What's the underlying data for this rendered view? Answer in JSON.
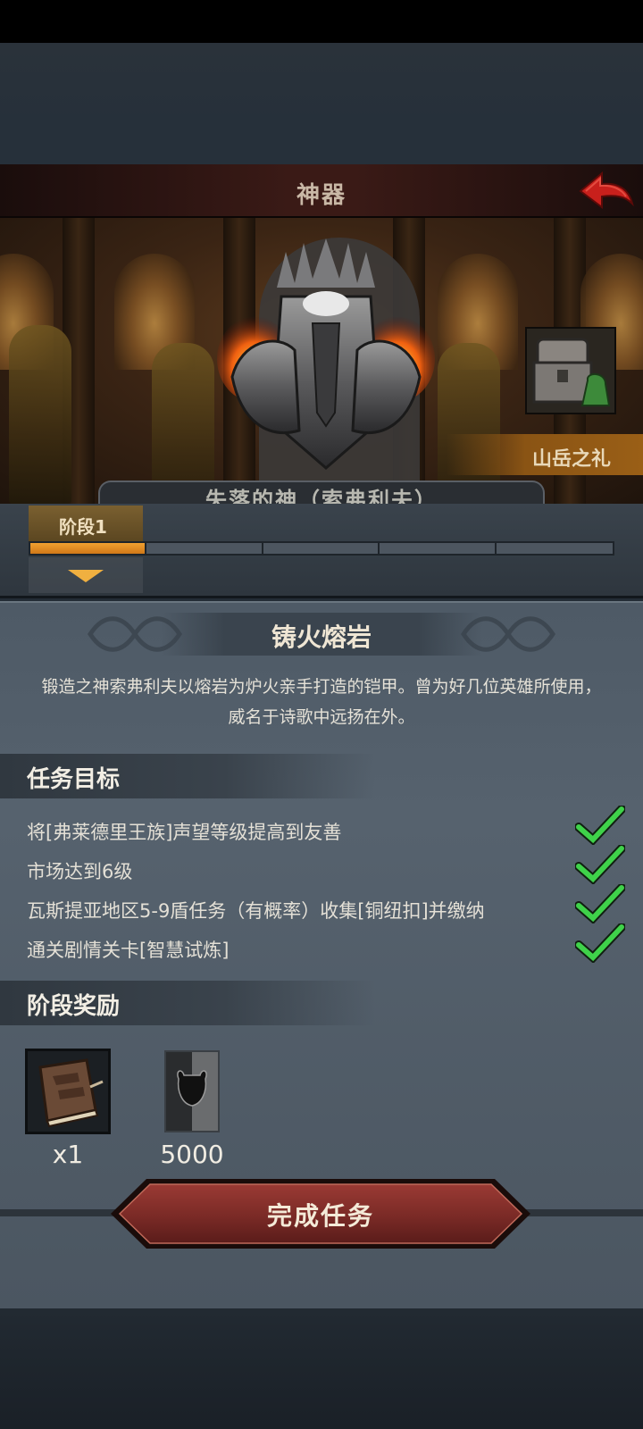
{
  "header": {
    "title": "神器"
  },
  "hero": {
    "chest_label": "山岳之礼",
    "name_plate": "失落的神（索弗利夫）"
  },
  "stage": {
    "tab_label": "阶段1",
    "progress_fraction": 0.2,
    "segments": 5
  },
  "artifact": {
    "name": "铸火熔岩",
    "description": "锻造之神索弗利夫以熔岩为炉火亲手打造的铠甲。曾为好几位英雄所使用，威名于诗歌中远扬在外。"
  },
  "tasks": {
    "title": "任务目标",
    "items": [
      {
        "text": "将[弗莱德里王族]声望等级提高到友善",
        "completed": true
      },
      {
        "text": "市场达到6级",
        "completed": true
      },
      {
        "text": "瓦斯提亚地区5-9盾任务（有概率）收集[铜纽扣]并缴纳",
        "completed": true
      },
      {
        "text": "通关剧情关卡[智慧试炼]",
        "completed": true
      }
    ]
  },
  "rewards": {
    "title": "阶段奖励",
    "items": [
      {
        "icon": "book-icon",
        "count": "x1"
      },
      {
        "icon": "bull-emblem-icon",
        "count": "5000"
      }
    ]
  },
  "actions": {
    "complete_label": "完成任务"
  },
  "colors": {
    "accent": "#e8901c",
    "check": "#3fd24a",
    "button": "#7a2a26"
  }
}
